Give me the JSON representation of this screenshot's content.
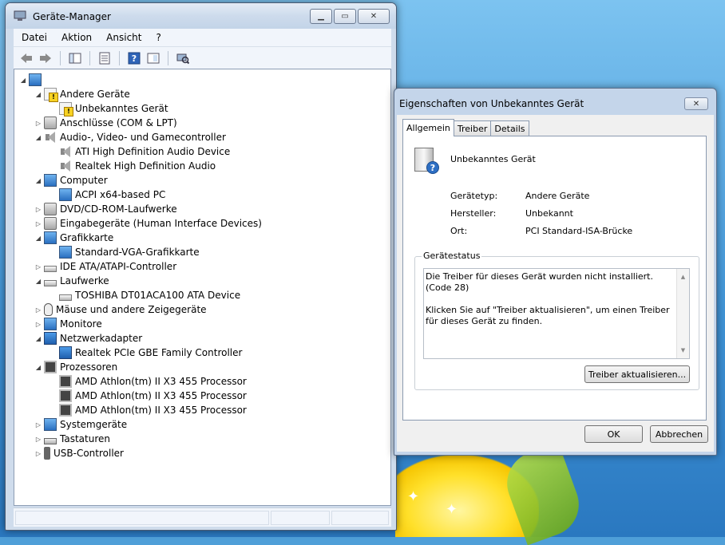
{
  "device_manager": {
    "title": "Geräte-Manager",
    "menu": [
      "Datei",
      "Aktion",
      "Ansicht",
      "?"
    ],
    "tree": [
      {
        "label": "",
        "level": 0,
        "expander": "expanded",
        "icon": "computer-root-icon"
      },
      {
        "label": "Andere Geräte",
        "level": 1,
        "expander": "expanded",
        "icon": "other-devices-icon"
      },
      {
        "label": "Unbekanntes Gerät",
        "level": 2,
        "expander": "none",
        "icon": "warning-device-icon"
      },
      {
        "label": "Anschlüsse (COM & LPT)",
        "level": 1,
        "expander": "collapsed",
        "icon": "ports-icon"
      },
      {
        "label": "Audio-, Video- und Gamecontroller",
        "level": 1,
        "expander": "expanded",
        "icon": "speaker-icon"
      },
      {
        "label": "ATI High Definition Audio Device",
        "level": 2,
        "expander": "none",
        "icon": "speaker-icon"
      },
      {
        "label": "Realtek High Definition Audio",
        "level": 2,
        "expander": "none",
        "icon": "speaker-icon"
      },
      {
        "label": "Computer",
        "level": 1,
        "expander": "expanded",
        "icon": "computer-icon"
      },
      {
        "label": "ACPI x64-based PC",
        "level": 2,
        "expander": "none",
        "icon": "computer-icon"
      },
      {
        "label": "DVD/CD-ROM-Laufwerke",
        "level": 1,
        "expander": "collapsed",
        "icon": "dvd-drive-icon"
      },
      {
        "label": "Eingabegeräte (Human Interface Devices)",
        "level": 1,
        "expander": "collapsed",
        "icon": "hid-icon"
      },
      {
        "label": "Grafikkarte",
        "level": 1,
        "expander": "expanded",
        "icon": "display-adapter-icon"
      },
      {
        "label": "Standard-VGA-Grafikkarte",
        "level": 2,
        "expander": "none",
        "icon": "display-adapter-icon"
      },
      {
        "label": "IDE ATA/ATAPI-Controller",
        "level": 1,
        "expander": "collapsed",
        "icon": "ide-controller-icon"
      },
      {
        "label": "Laufwerke",
        "level": 1,
        "expander": "expanded",
        "icon": "disk-drive-icon"
      },
      {
        "label": "TOSHIBA DT01ACA100 ATA Device",
        "level": 2,
        "expander": "none",
        "icon": "disk-drive-icon"
      },
      {
        "label": "Mäuse und andere Zeigegeräte",
        "level": 1,
        "expander": "collapsed",
        "icon": "mouse-icon"
      },
      {
        "label": "Monitore",
        "level": 1,
        "expander": "collapsed",
        "icon": "monitor-icon"
      },
      {
        "label": "Netzwerkadapter",
        "level": 1,
        "expander": "expanded",
        "icon": "network-adapter-icon"
      },
      {
        "label": "Realtek PCIe GBE Family Controller",
        "level": 2,
        "expander": "none",
        "icon": "network-adapter-icon"
      },
      {
        "label": "Prozessoren",
        "level": 1,
        "expander": "expanded",
        "icon": "cpu-icon"
      },
      {
        "label": "AMD Athlon(tm) II X3 455 Processor",
        "level": 2,
        "expander": "none",
        "icon": "cpu-icon"
      },
      {
        "label": "AMD Athlon(tm) II X3 455 Processor",
        "level": 2,
        "expander": "none",
        "icon": "cpu-icon"
      },
      {
        "label": "AMD Athlon(tm) II X3 455 Processor",
        "level": 2,
        "expander": "none",
        "icon": "cpu-icon"
      },
      {
        "label": "Systemgeräte",
        "level": 1,
        "expander": "collapsed",
        "icon": "system-devices-icon"
      },
      {
        "label": "Tastaturen",
        "level": 1,
        "expander": "collapsed",
        "icon": "keyboard-icon"
      },
      {
        "label": "USB-Controller",
        "level": 1,
        "expander": "collapsed",
        "icon": "usb-icon"
      }
    ]
  },
  "properties_dialog": {
    "title": "Eigenschaften von Unbekanntes Gerät",
    "tabs": [
      "Allgemein",
      "Treiber",
      "Details"
    ],
    "active_tab": "Allgemein",
    "device_name": "Unbekanntes Gerät",
    "fields": [
      {
        "label": "Gerätetyp:",
        "value": "Andere Geräte"
      },
      {
        "label": "Hersteller:",
        "value": "Unbekannt"
      },
      {
        "label": "Ort:",
        "value": "PCI Standard-ISA-Brücke"
      }
    ],
    "status_group_label": "Gerätestatus",
    "status_lines": [
      "Die Treiber für dieses Gerät wurden nicht installiert. (Code 28)",
      "Klicken Sie auf \"Treiber aktualisieren\", um einen Treiber für dieses Gerät zu finden."
    ],
    "update_driver_button": "Treiber aktualisieren...",
    "ok_button": "OK",
    "cancel_button": "Abbrechen"
  }
}
